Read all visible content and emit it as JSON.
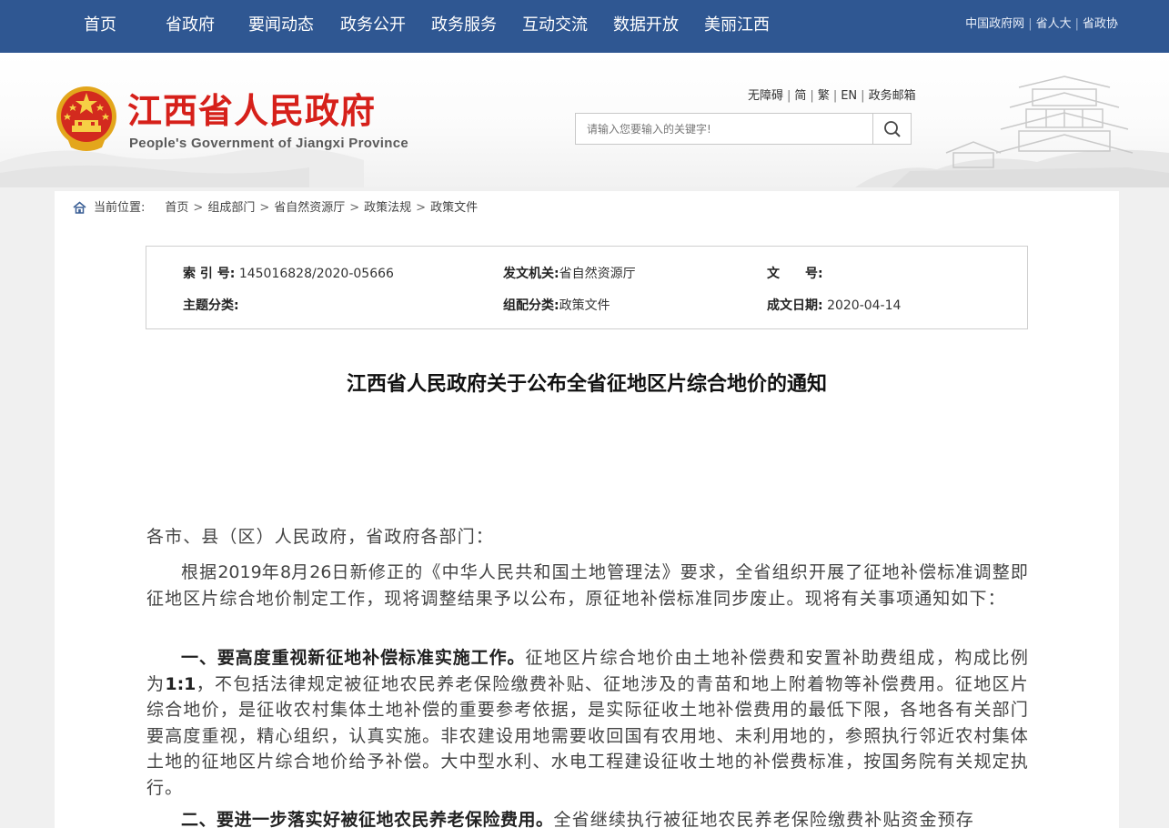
{
  "topnav": {
    "items": [
      {
        "label": "首页"
      },
      {
        "label": "省政府"
      },
      {
        "label": "要闻动态"
      },
      {
        "label": "政务公开"
      },
      {
        "label": "政务服务"
      },
      {
        "label": "互动交流"
      },
      {
        "label": "数据开放"
      },
      {
        "label": "美丽江西"
      }
    ],
    "ext_links": [
      "中国政府网",
      "省人大",
      "省政协"
    ]
  },
  "header": {
    "title": "江西省人民政府",
    "subtitle": "People's Government of Jiangxi Province",
    "util_links": [
      "无障碍",
      "简",
      "繁",
      "EN",
      "政务邮箱"
    ],
    "search_placeholder": "请输入您要输入的关键字!"
  },
  "breadcrumb": {
    "label": "当前位置:",
    "items": [
      "首页",
      "组成部门",
      "省自然资源厅",
      "政策法规",
      "政策文件"
    ]
  },
  "meta": {
    "index_label": "索 引 号:",
    "index_value": "145016828/2020-05666",
    "issuer_label": "发文机关:",
    "issuer_value": "省自然资源厅",
    "docno_label": "文　　号:",
    "docno_value": "",
    "topic_label": "主题分类:",
    "topic_value": "",
    "category_label": "组配分类:",
    "category_value": "政策文件",
    "date_label": "成文日期:",
    "date_value": "2020-04-14"
  },
  "document": {
    "title": "江西省人民政府关于公布全省征地区片综合地价的通知",
    "salutation": "各市、县（区）人民政府，省政府各部门：",
    "p1_a": "根据",
    "p1_year": "2019",
    "p1_b": "年",
    "p1_month": "8",
    "p1_c": "月",
    "p1_day": "26",
    "p1_d": "日新修正的《中华人民共和国土地管理法》要求，全省组织开展了征地补偿标准调整即征地区片综合地价制定工作，现将调整结果予以公布，原征地补偿标准同步废止。现将有关事项通知如下：",
    "s1_heading": "一、要高度重视新征地补偿标准实施工作。",
    "s1_a": "征地区片综合地价由土地补偿费和安置补助费组成，构成比例为",
    "s1_ratio": "1:1",
    "s1_b": "，不包括法律规定被征地农民养老保险缴费补贴、征地涉及的青苗和地上附着物等补偿费用。征地区片综合地价，是征收农村集体土地补偿的重要参考依据，是实际征收土地补偿费用的最低下限，各地各有关部门要高度重视，精心组织，认真实施。非农建设用地需要收回国有农用地、未利用地的，参照执行邻近农村集体土地的征地区片综合地价给予补偿。大中型水利、水电工程建设征收土地的补偿费标准，按国务院有关规定执行。",
    "s2_heading": "二、要进一步落实好被征地农民养老保险费用。",
    "s2_a": "全省继续执行被征地农民养老保险缴费补贴资金预存"
  }
}
